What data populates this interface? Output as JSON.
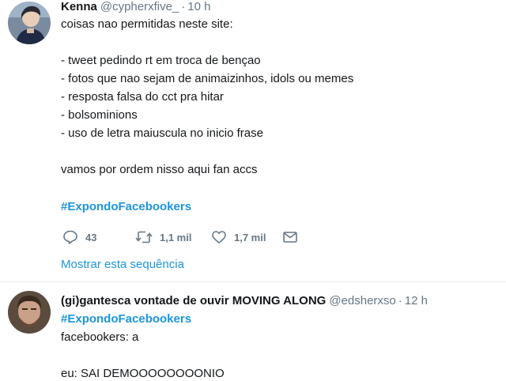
{
  "tweets": [
    {
      "name": "Kenna",
      "handle": "@cypherxfive_",
      "separator": "·",
      "time": "10 h",
      "lines": [
        "coisas nao permitidas neste site:",
        "- tweet pedindo rt em troca de bençao",
        "- fotos que nao sejam de animaizinhos, idols ou memes",
        "- resposta falsa do cct pra hitar",
        "- bolsominions",
        "- uso de letra maiuscula no inicio frase",
        "vamos por ordem nisso aqui fan accs"
      ],
      "hashtag": "#ExpondoFacebookers",
      "actions": {
        "replies": "43",
        "retweets": "1,1 mil",
        "likes": "1,7 mil"
      },
      "show_thread": "Mostrar esta sequência"
    },
    {
      "name": "(gi)gantesca vontade de ouvir MOVING ALONG",
      "handle": "@edsherxso",
      "separator": "·",
      "time": "12 h",
      "hashtag": "#ExpondoFacebookers",
      "lines": [
        "facebookers: a",
        "eu: SAI DEMOOOOOOOONIO"
      ]
    }
  ],
  "colors": {
    "text": "#14171a",
    "secondary": "#657786",
    "link": "#1b95e0",
    "divider": "#e6ecf0"
  },
  "icons": [
    "reply-icon",
    "retweet-icon",
    "like-icon",
    "direct-message-icon"
  ]
}
